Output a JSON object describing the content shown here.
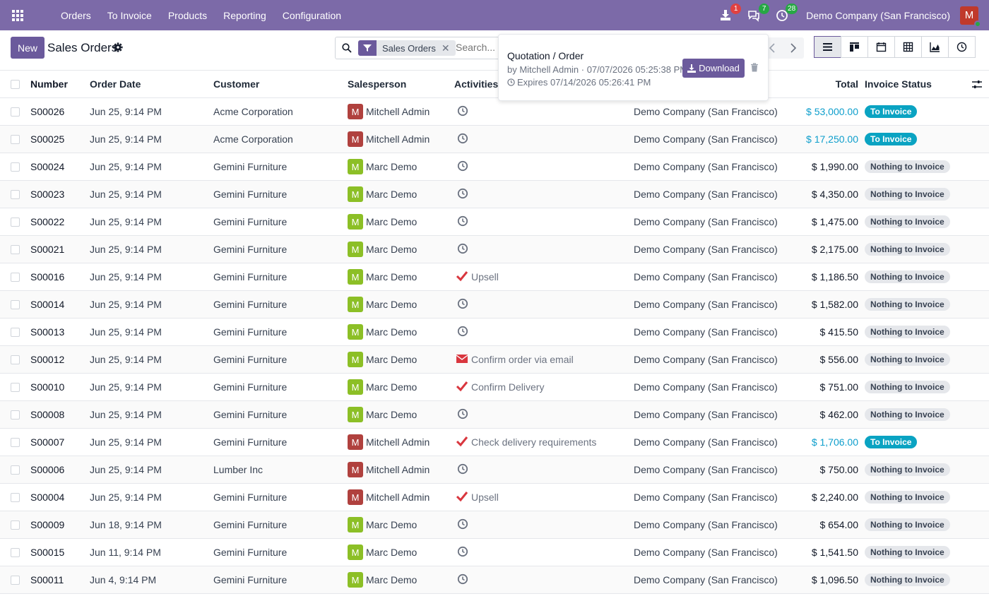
{
  "navbar": {
    "menu": [
      "Orders",
      "To Invoice",
      "Products",
      "Reporting",
      "Configuration"
    ],
    "activity_badge": "1",
    "messages_badge": "7",
    "clock_badge": "28",
    "company": "Demo Company (San Francisco)",
    "user_initial": "M"
  },
  "control": {
    "new_label": "New",
    "title": "Sales Orders",
    "facet": "Sales Orders",
    "facet_close": "✕",
    "search_placeholder": "Search..."
  },
  "popover": {
    "title": "Quotation / Order",
    "by": "by Mitchell Admin · 07/07/2026 05:25:38 PM",
    "expires": "Expires 07/14/2026 05:26:41 PM",
    "download": "Download"
  },
  "table": {
    "headers": {
      "number": "Number",
      "order_date": "Order Date",
      "customer": "Customer",
      "salesperson": "Salesperson",
      "activities": "Activities",
      "total": "Total",
      "invoice_status": "Invoice Status"
    },
    "rows": [
      {
        "number": "S00026",
        "date": "Jun 25, 9:14 PM",
        "customer": "Acme Corporation",
        "sp_initial": "M",
        "salesperson": "Mitchell Admin",
        "sp_color": "#b0413e",
        "act_type": "clock",
        "activity": "",
        "company": "Demo Company (San Francisco)",
        "total": "$ 53,000.00",
        "total_blue": true,
        "status": "To Invoice",
        "status_type": "blue"
      },
      {
        "number": "S00025",
        "date": "Jun 25, 9:14 PM",
        "customer": "Acme Corporation",
        "sp_initial": "M",
        "salesperson": "Mitchell Admin",
        "sp_color": "#b0413e",
        "act_type": "clock",
        "activity": "",
        "company": "Demo Company (San Francisco)",
        "total": "$ 17,250.00",
        "total_blue": true,
        "status": "To Invoice",
        "status_type": "blue"
      },
      {
        "number": "S00024",
        "date": "Jun 25, 9:14 PM",
        "customer": "Gemini Furniture",
        "sp_initial": "M",
        "salesperson": "Marc Demo",
        "sp_color": "#8cbf26",
        "act_type": "clock",
        "activity": "",
        "company": "Demo Company (San Francisco)",
        "total": "$ 1,990.00",
        "total_blue": false,
        "status": "Nothing to Invoice",
        "status_type": "gray"
      },
      {
        "number": "S00023",
        "date": "Jun 25, 9:14 PM",
        "customer": "Gemini Furniture",
        "sp_initial": "M",
        "salesperson": "Marc Demo",
        "sp_color": "#8cbf26",
        "act_type": "clock",
        "activity": "",
        "company": "Demo Company (San Francisco)",
        "total": "$ 4,350.00",
        "total_blue": false,
        "status": "Nothing to Invoice",
        "status_type": "gray"
      },
      {
        "number": "S00022",
        "date": "Jun 25, 9:14 PM",
        "customer": "Gemini Furniture",
        "sp_initial": "M",
        "salesperson": "Marc Demo",
        "sp_color": "#8cbf26",
        "act_type": "clock",
        "activity": "",
        "company": "Demo Company (San Francisco)",
        "total": "$ 1,475.00",
        "total_blue": false,
        "status": "Nothing to Invoice",
        "status_type": "gray"
      },
      {
        "number": "S00021",
        "date": "Jun 25, 9:14 PM",
        "customer": "Gemini Furniture",
        "sp_initial": "M",
        "salesperson": "Marc Demo",
        "sp_color": "#8cbf26",
        "act_type": "clock",
        "activity": "",
        "company": "Demo Company (San Francisco)",
        "total": "$ 2,175.00",
        "total_blue": false,
        "status": "Nothing to Invoice",
        "status_type": "gray"
      },
      {
        "number": "S00016",
        "date": "Jun 25, 9:14 PM",
        "customer": "Gemini Furniture",
        "sp_initial": "M",
        "salesperson": "Marc Demo",
        "sp_color": "#8cbf26",
        "act_type": "check",
        "activity": "Upsell",
        "company": "Demo Company (San Francisco)",
        "total": "$ 1,186.50",
        "total_blue": false,
        "status": "Nothing to Invoice",
        "status_type": "gray"
      },
      {
        "number": "S00014",
        "date": "Jun 25, 9:14 PM",
        "customer": "Gemini Furniture",
        "sp_initial": "M",
        "salesperson": "Marc Demo",
        "sp_color": "#8cbf26",
        "act_type": "clock",
        "activity": "",
        "company": "Demo Company (San Francisco)",
        "total": "$ 1,582.00",
        "total_blue": false,
        "status": "Nothing to Invoice",
        "status_type": "gray"
      },
      {
        "number": "S00013",
        "date": "Jun 25, 9:14 PM",
        "customer": "Gemini Furniture",
        "sp_initial": "M",
        "salesperson": "Marc Demo",
        "sp_color": "#8cbf26",
        "act_type": "clock",
        "activity": "",
        "company": "Demo Company (San Francisco)",
        "total": "$ 415.50",
        "total_blue": false,
        "status": "Nothing to Invoice",
        "status_type": "gray"
      },
      {
        "number": "S00012",
        "date": "Jun 25, 9:14 PM",
        "customer": "Gemini Furniture",
        "sp_initial": "M",
        "salesperson": "Marc Demo",
        "sp_color": "#8cbf26",
        "act_type": "email",
        "activity": "Confirm order via email",
        "company": "Demo Company (San Francisco)",
        "total": "$ 556.00",
        "total_blue": false,
        "status": "Nothing to Invoice",
        "status_type": "gray"
      },
      {
        "number": "S00010",
        "date": "Jun 25, 9:14 PM",
        "customer": "Gemini Furniture",
        "sp_initial": "M",
        "salesperson": "Marc Demo",
        "sp_color": "#8cbf26",
        "act_type": "check",
        "activity": "Confirm Delivery",
        "company": "Demo Company (San Francisco)",
        "total": "$ 751.00",
        "total_blue": false,
        "status": "Nothing to Invoice",
        "status_type": "gray"
      },
      {
        "number": "S00008",
        "date": "Jun 25, 9:14 PM",
        "customer": "Gemini Furniture",
        "sp_initial": "M",
        "salesperson": "Marc Demo",
        "sp_color": "#8cbf26",
        "act_type": "clock",
        "activity": "",
        "company": "Demo Company (San Francisco)",
        "total": "$ 462.00",
        "total_blue": false,
        "status": "Nothing to Invoice",
        "status_type": "gray"
      },
      {
        "number": "S00007",
        "date": "Jun 25, 9:14 PM",
        "customer": "Gemini Furniture",
        "sp_initial": "M",
        "salesperson": "Mitchell Admin",
        "sp_color": "#b0413e",
        "act_type": "check",
        "activity": "Check delivery requirements",
        "company": "Demo Company (San Francisco)",
        "total": "$ 1,706.00",
        "total_blue": true,
        "status": "To Invoice",
        "status_type": "blue"
      },
      {
        "number": "S00006",
        "date": "Jun 25, 9:14 PM",
        "customer": "Lumber Inc",
        "sp_initial": "M",
        "salesperson": "Mitchell Admin",
        "sp_color": "#b0413e",
        "act_type": "clock",
        "activity": "",
        "company": "Demo Company (San Francisco)",
        "total": "$ 750.00",
        "total_blue": false,
        "status": "Nothing to Invoice",
        "status_type": "gray"
      },
      {
        "number": "S00004",
        "date": "Jun 25, 9:14 PM",
        "customer": "Gemini Furniture",
        "sp_initial": "M",
        "salesperson": "Mitchell Admin",
        "sp_color": "#b0413e",
        "act_type": "check",
        "activity": "Upsell",
        "company": "Demo Company (San Francisco)",
        "total": "$ 2,240.00",
        "total_blue": false,
        "status": "Nothing to Invoice",
        "status_type": "gray"
      },
      {
        "number": "S00009",
        "date": "Jun 18, 9:14 PM",
        "customer": "Gemini Furniture",
        "sp_initial": "M",
        "salesperson": "Marc Demo",
        "sp_color": "#8cbf26",
        "act_type": "clock",
        "activity": "",
        "company": "Demo Company (San Francisco)",
        "total": "$ 654.00",
        "total_blue": false,
        "status": "Nothing to Invoice",
        "status_type": "gray"
      },
      {
        "number": "S00015",
        "date": "Jun 11, 9:14 PM",
        "customer": "Gemini Furniture",
        "sp_initial": "M",
        "salesperson": "Marc Demo",
        "sp_color": "#8cbf26",
        "act_type": "clock",
        "activity": "",
        "company": "Demo Company (San Francisco)",
        "total": "$ 1,541.50",
        "total_blue": false,
        "status": "Nothing to Invoice",
        "status_type": "gray"
      },
      {
        "number": "S00011",
        "date": "Jun 4, 9:14 PM",
        "customer": "Gemini Furniture",
        "sp_initial": "M",
        "salesperson": "Marc Demo",
        "sp_color": "#8cbf26",
        "act_type": "clock",
        "activity": "",
        "company": "Demo Company (San Francisco)",
        "total": "$ 1,096.50",
        "total_blue": false,
        "status": "Nothing to Invoice",
        "status_type": "gray"
      }
    ]
  }
}
